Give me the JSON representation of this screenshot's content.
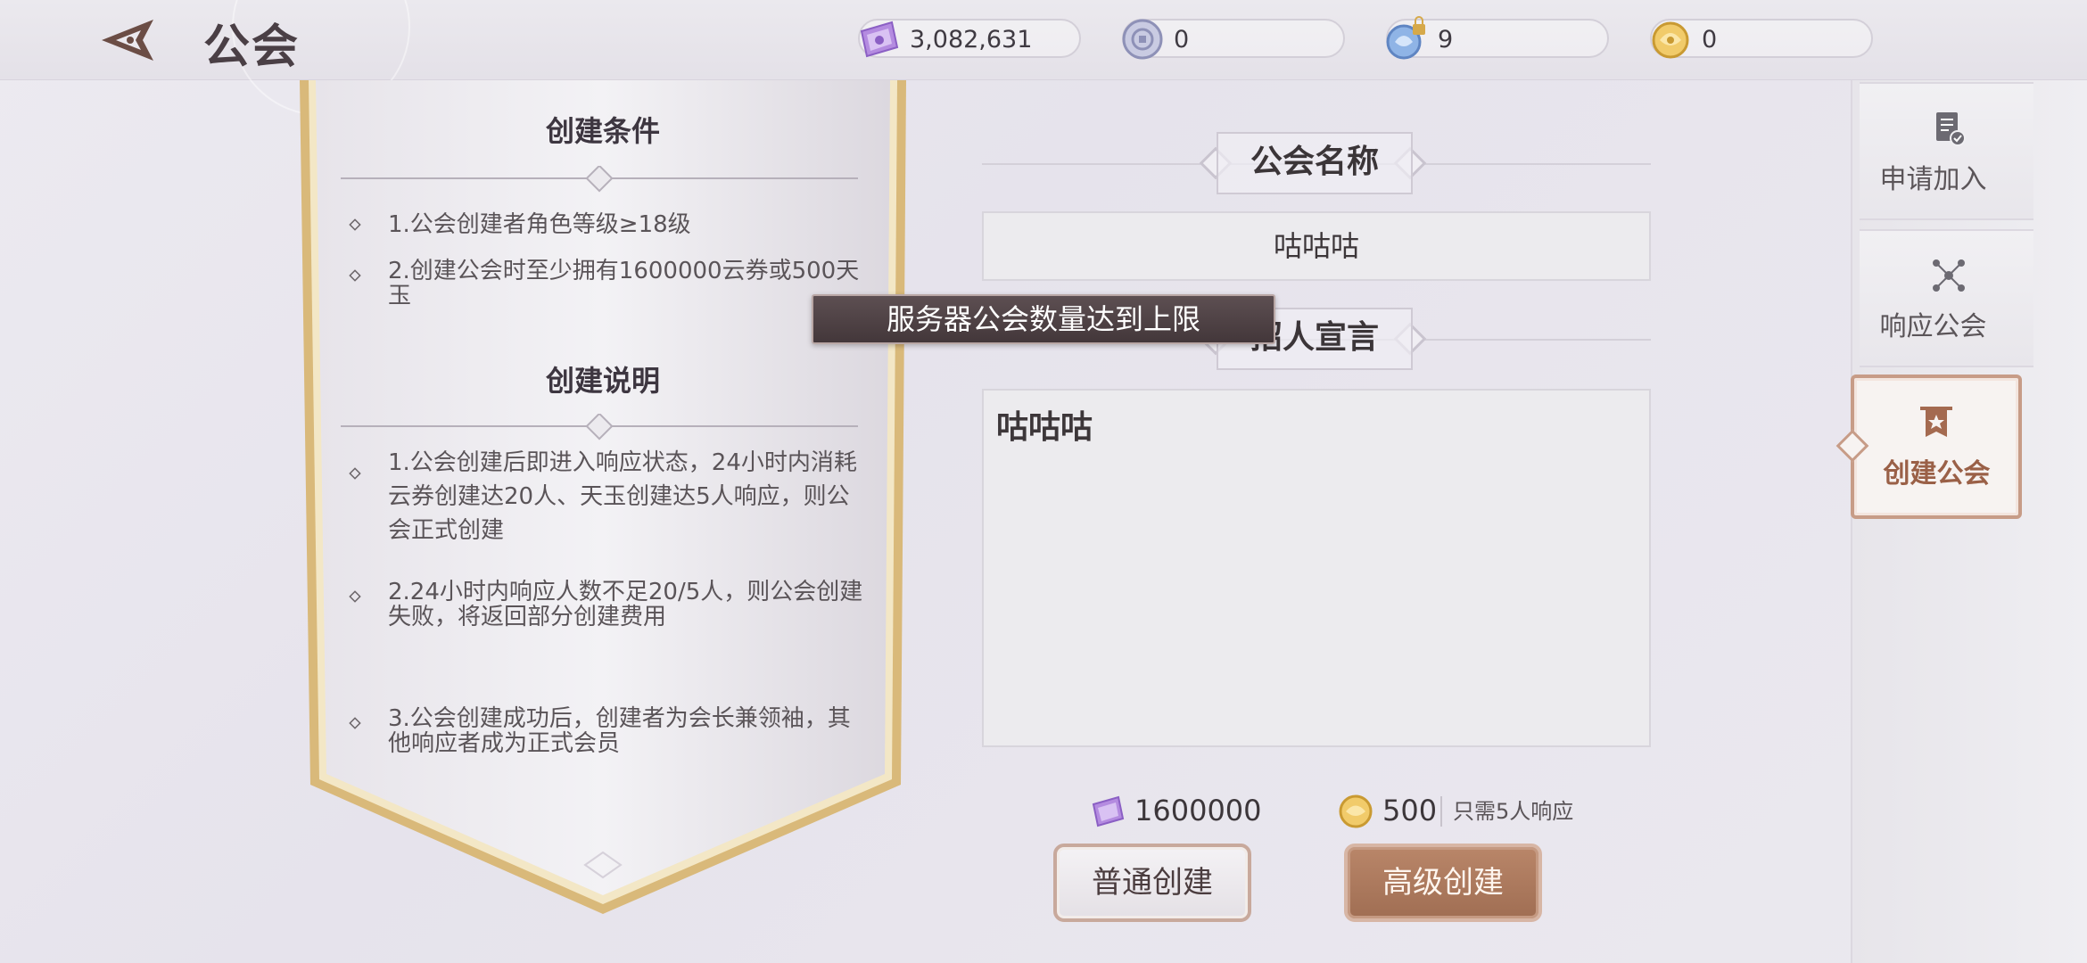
{
  "header": {
    "title": "公会",
    "currencies": [
      {
        "name": "cloud-ticket",
        "value": "3,082,631"
      },
      {
        "name": "coin",
        "value": "0"
      },
      {
        "name": "jade-locked",
        "value": "9"
      },
      {
        "name": "gold-jade",
        "value": "0"
      }
    ]
  },
  "conditions": {
    "title": "创建条件",
    "items": [
      "1.公会创建者角色等级≥18级",
      "2.创建公会时至少拥有1600000云券或500天玉"
    ]
  },
  "notes": {
    "title": "创建说明",
    "items": [
      "1.公会创建后即进入响应状态，24小时内消耗云券创建达20人、天玉创建达5人响应，则公会正式创建",
      "2.24小时内响应人数不足20/5人，则公会创建失败，将返回部分创建费用",
      "3.公会创建成功后，创建者为会长兼领袖，其他响应者成为正式会员"
    ]
  },
  "toast": "服务器公会数量达到上限",
  "form": {
    "name_label": "公会名称",
    "name_value": "咕咕咕",
    "slogan_label": "招人宣言",
    "slogan_value": "咕咕咕"
  },
  "costs": {
    "normal_cost": "1600000",
    "advanced_cost": "500",
    "advanced_note": "只需5人响应"
  },
  "buttons": {
    "normal": "普通创建",
    "advanced": "高级创建"
  },
  "sidebar": {
    "tabs": [
      {
        "label": "申请加入",
        "icon": "document-check-icon"
      },
      {
        "label": "响应公会",
        "icon": "network-icon"
      },
      {
        "label": "创建公会",
        "icon": "banner-star-icon",
        "active": true
      }
    ]
  },
  "colors": {
    "accent": "#a06e53",
    "active_tab": "#9a6047",
    "banner_gold": "#d9b97a"
  }
}
